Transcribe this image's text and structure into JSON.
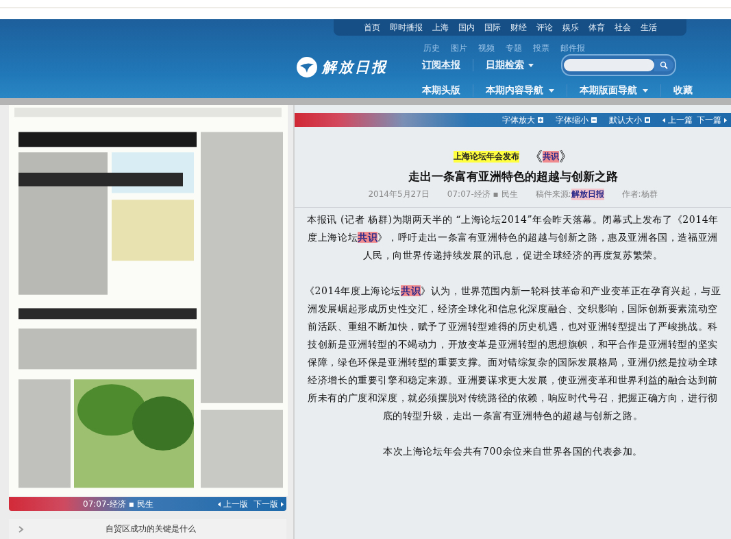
{
  "header": {
    "top_nav": [
      "首页",
      "即时播报",
      "上海",
      "国内",
      "国际",
      "财经",
      "评论",
      "娱乐",
      "体育",
      "社会",
      "生活"
    ],
    "sub_links": [
      "历史",
      "图片",
      "视频",
      "专题",
      "投票",
      "邮件报"
    ],
    "logo": "解放日报",
    "subscribe_link": "订阅本报",
    "date_search": "日期检索",
    "main_nav": [
      {
        "label": "本期头版",
        "dropdown": false
      },
      {
        "label": "本期内容导航",
        "dropdown": true
      },
      {
        "label": "本期版面导航",
        "dropdown": true
      },
      {
        "label": "收藏",
        "dropdown": false
      }
    ]
  },
  "page_panel": {
    "pager": {
      "section": "07:07-经济 ▪ 民生",
      "prev": "上一版",
      "next": "下一版"
    },
    "article_links": [
      {
        "title": "自贸区成功的关键是什么"
      }
    ]
  },
  "article": {
    "toolbar": [
      {
        "label": "字体放大",
        "kind": "plus"
      },
      {
        "label": "字体缩小",
        "kind": "minus"
      },
      {
        "label": "默认大小",
        "kind": "square"
      }
    ],
    "prev": "上一篇",
    "next": "下一篇",
    "kicker": "上海论坛年会发布",
    "subtitle_open": "《",
    "subtitle": "共识",
    "subtitle_close": "》",
    "headline": "走出一条富有亚洲特色的超越与创新之路",
    "meta": {
      "date": "2014年5月27日",
      "section": "07:07-经济 ▪ 民生",
      "source_label": "稿件来源:",
      "source": "解放日报",
      "author": "作者:杨群"
    },
    "paragraphs": [
      [
        {
          "text": "本报讯 (记者 杨群)为期两天半的 “上海论坛2014”年会昨天落幕。闭幕式上发布了《2014年度上海论坛",
          "highlight": false
        },
        {
          "text": "共识",
          "highlight": true
        },
        {
          "text": "》，呼吁走出一条富有亚洲特色的超越与创新之路，惠及亚洲各国，造福亚洲人民，向世界传递持续发展的讯息，促进全球经济的再度复苏繁荣。",
          "highlight": false
        }
      ],
      [
        {
          "text": "《2014年度上海论坛",
          "highlight": false
        },
        {
          "text": "共识",
          "highlight": true
        },
        {
          "text": "》认为，世界范围内新一轮科技革命和产业变革正在孕育兴起，与亚洲发展崛起形成历史性交汇，经济全球化和信息化深度融合、交织影响，国际创新要素流动空前活跃、重组不断加快，赋予了亚洲转型难得的历史机遇，也对亚洲转型提出了严峻挑战。科技创新是亚洲转型的不竭动力，开放变革是亚洲转型的思想旗帜，和平合作是亚洲转型的坚实保障，绿色环保是亚洲转型的重要支撑。面对错综复杂的国际发展格局，亚洲仍然是拉动全球经济增长的重要引擎和稳定来源。亚洲要谋求更大发展，使亚洲变革和世界利益的融合达到前所未有的广度和深度，就必须摆脱对传统路径的依赖，响应时代号召，把握正确方向，进行彻底的转型升级，走出一条富有亚洲特色的超越与创新之路。",
          "highlight": false
        }
      ],
      [
        {
          "text": "本次上海论坛年会共有700余位来自世界各国的代表参加。",
          "highlight": false
        }
      ]
    ]
  }
}
